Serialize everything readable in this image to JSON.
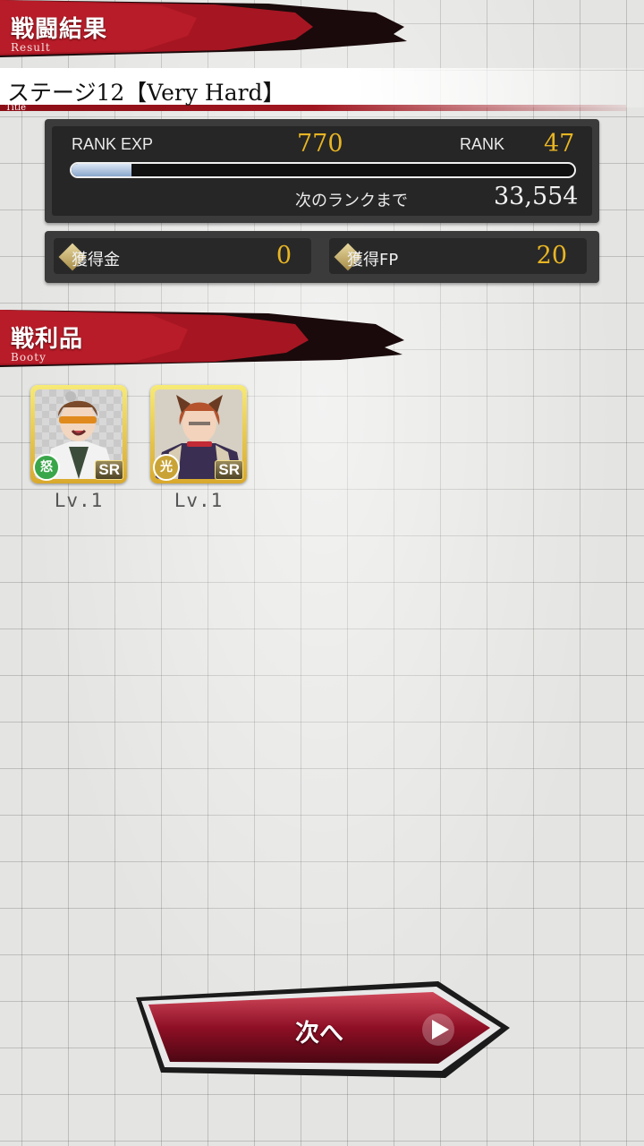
{
  "header": {
    "title_jp": "戦闘結果",
    "title_en": "Result",
    "accent": "#a51622"
  },
  "stage": {
    "name": "ステージ12【Very Hard】",
    "caption": "Title"
  },
  "rank_panel": {
    "exp_label": "RANK EXP",
    "exp_value": "770",
    "rank_label": "RANK",
    "rank_value": "47",
    "exp_progress_pct": 12,
    "next_label": "次のランクまで",
    "next_value": "33,554"
  },
  "rewards": {
    "money_label": "獲得金",
    "money_value": "0",
    "fp_label": "獲得FP",
    "fp_value": "20"
  },
  "booty": {
    "title_jp": "戦利品",
    "title_en": "Booty",
    "items": [
      {
        "rarity": "SR",
        "attribute": "怒",
        "attribute_color": "#3aa64a",
        "level": "Lv.1"
      },
      {
        "rarity": "SR",
        "attribute": "光",
        "attribute_color": "#c9a336",
        "level": "Lv.1"
      }
    ]
  },
  "next_button": {
    "label": "次へ",
    "icon": "play-arrow-icon"
  }
}
